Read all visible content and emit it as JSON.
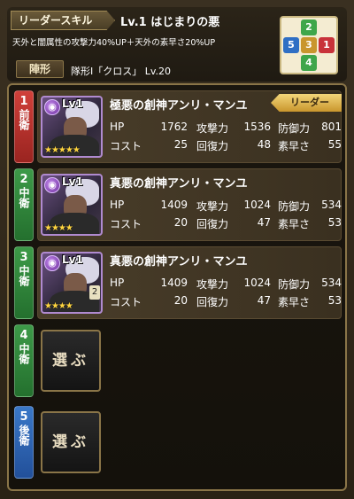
{
  "leader_skill": {
    "tag": "リーダースキル",
    "title": "Lv.1 はじまりの悪",
    "description": "天外と闇属性の攻撃力40%UP＋天外の素早さ20%UP"
  },
  "formation": {
    "tag": "陣形",
    "name": "隊形Ⅰ「クロス」 Lv.20",
    "grid": {
      "top": "2",
      "left": "5",
      "center": "3",
      "right": "1",
      "bottom": "4"
    }
  },
  "slots": [
    {
      "number": "1",
      "position": "前衛",
      "level": "Lv1",
      "name": "極悪の創神アンリ・マンユ",
      "leader_badge": "リーダー",
      "hp_label": "HP",
      "hp": "1762",
      "atk_label": "攻撃力",
      "atk": "1536",
      "def_label": "防御力",
      "def": "801",
      "cost_label": "コスト",
      "cost": "25",
      "rec_label": "回復力",
      "rec": "48",
      "spd_label": "素早さ",
      "spd": "55",
      "stars": "★★★★★"
    },
    {
      "number": "2",
      "position": "中衛",
      "level": "Lv1",
      "name": "真悪の創神アンリ・マンユ",
      "hp_label": "HP",
      "hp": "1409",
      "atk_label": "攻撃力",
      "atk": "1024",
      "def_label": "防御力",
      "def": "534",
      "cost_label": "コスト",
      "cost": "20",
      "rec_label": "回復力",
      "rec": "47",
      "spd_label": "素早さ",
      "spd": "53",
      "stars": "★★★★"
    },
    {
      "number": "3",
      "position": "中衛",
      "level": "Lv1",
      "name": "真悪の創神アンリ・マンユ",
      "hp_label": "HP",
      "hp": "1409",
      "atk_label": "攻撃力",
      "atk": "1024",
      "def_label": "防御力",
      "def": "534",
      "cost_label": "コスト",
      "cost": "20",
      "rec_label": "回復力",
      "rec": "47",
      "spd_label": "素早さ",
      "spd": "53",
      "stars": "★★★★",
      "card_num": "2"
    },
    {
      "number": "4",
      "position": "中衛",
      "empty_label": "選ぶ"
    },
    {
      "number": "5",
      "position": "後衛",
      "empty_label": "選ぶ"
    }
  ]
}
